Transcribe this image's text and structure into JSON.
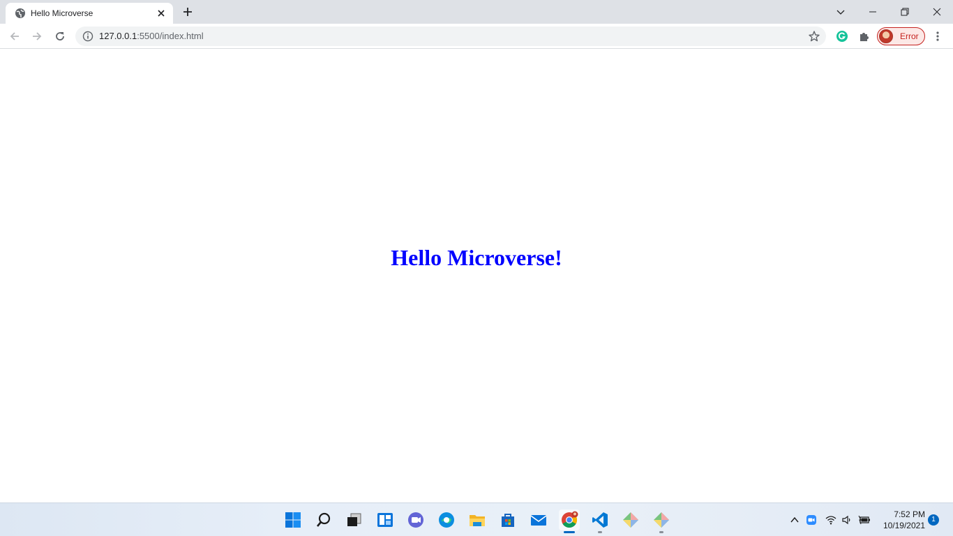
{
  "browser": {
    "tab": {
      "title": "Hello Microverse"
    },
    "address": {
      "host": "127.0.0.1",
      "rest": ":5500/index.html"
    },
    "profile": {
      "label": "Error"
    },
    "icons": [
      "globe-icon",
      "close-icon",
      "plus-icon",
      "back-icon",
      "forward-icon",
      "reload-icon",
      "info-icon",
      "star-icon",
      "grammarly-icon",
      "puzzle-icon",
      "kebab-icon"
    ],
    "window_controls": [
      "chevron-down-icon",
      "minimize-icon",
      "restore-icon",
      "close-window-icon"
    ]
  },
  "page": {
    "heading": "Hello Microverse!",
    "heading_color": "#0000ff"
  },
  "taskbar": {
    "apps": [
      "windows-start",
      "search",
      "task-view",
      "widgets",
      "chat",
      "edge",
      "file-explorer",
      "store",
      "mail",
      "chrome",
      "vscode",
      "git-app-1",
      "git-app-2"
    ],
    "clock": {
      "time": "7:52 PM",
      "date": "10/19/2021"
    },
    "notifications": "1"
  }
}
